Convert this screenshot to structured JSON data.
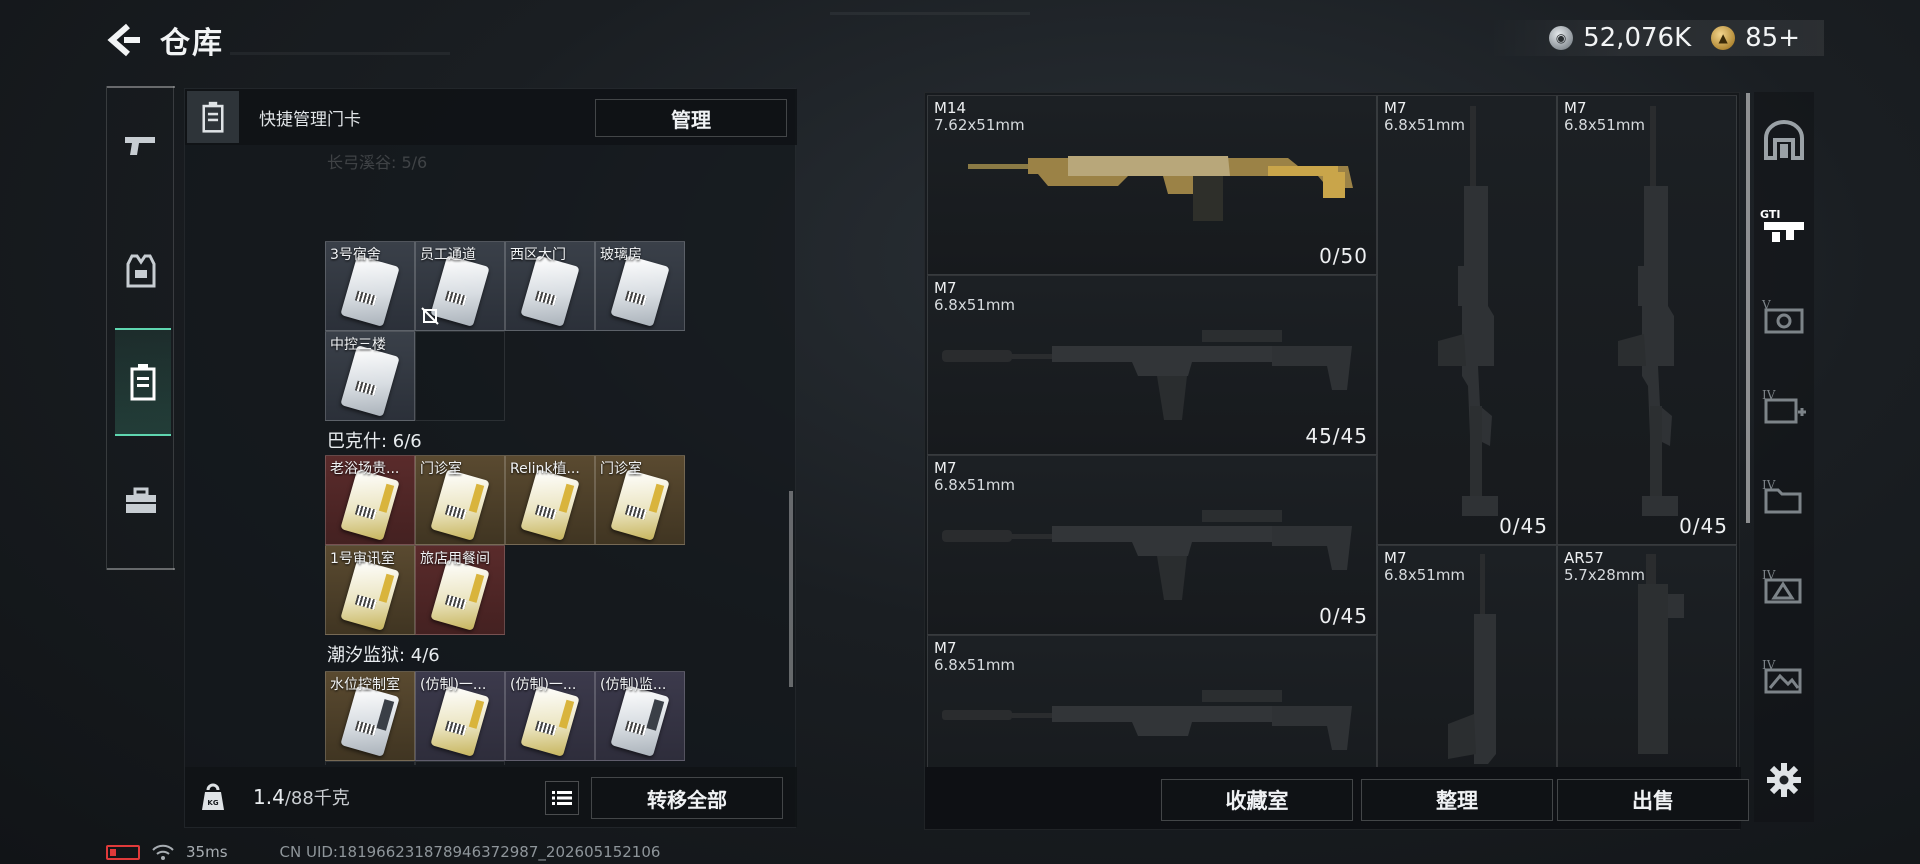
{
  "header": {
    "title": "仓库",
    "currency": [
      {
        "icon": "silver-coin-icon",
        "value": "52,076K"
      },
      {
        "icon": "gold-token-icon",
        "value": "85+"
      }
    ]
  },
  "left_nav": [
    {
      "icon": "pistol-icon",
      "active": false
    },
    {
      "icon": "vest-icon",
      "active": false
    },
    {
      "icon": "keycard-icon",
      "active": true
    },
    {
      "icon": "toolbox-icon",
      "active": false
    }
  ],
  "left_panel": {
    "title": "快捷管理门卡",
    "manage_label": "管理",
    "ghost_heading": "长弓溪谷: 5/6",
    "section_1": {
      "cards": [
        {
          "label": "3号宿舍",
          "color": "blue",
          "card": "white"
        },
        {
          "label": "员工通道",
          "color": "blue",
          "card": "white",
          "no_entry": true
        },
        {
          "label": "西区大门",
          "color": "blue",
          "card": "white"
        },
        {
          "label": "玻璃房",
          "color": "blue",
          "card": "white"
        },
        {
          "label": "中控三楼",
          "color": "blue",
          "card": "white"
        }
      ]
    },
    "section_2": {
      "title": "巴克什: 6/6",
      "cards": [
        {
          "label": "老浴场贵...",
          "color": "red",
          "card": "yellow"
        },
        {
          "label": "门诊室",
          "color": "gold",
          "card": "yellow"
        },
        {
          "label": "Relink植...",
          "color": "gold",
          "card": "yellow"
        },
        {
          "label": "门诊室",
          "color": "gold",
          "card": "yellow"
        },
        {
          "label": "1号审讯室",
          "color": "gold",
          "card": "yellow"
        },
        {
          "label": "旅店用餐间",
          "color": "red",
          "card": "yellow"
        }
      ]
    },
    "section_3": {
      "title": "潮汐监狱: 4/6",
      "cards": [
        {
          "label": "水位控制室",
          "color": "gold",
          "card": "dark"
        },
        {
          "label": "(仿制)一...",
          "color": "purple",
          "card": "yellow"
        },
        {
          "label": "(仿制)一...",
          "color": "purple",
          "card": "yellow"
        },
        {
          "label": "(仿制)监...",
          "color": "purple",
          "card": "dark"
        }
      ]
    },
    "weight_value": "1.4",
    "weight_max": "/88千克",
    "transfer_label": "转移全部"
  },
  "weapons": [
    {
      "name": "M14",
      "caliber": "7.62x51mm",
      "ammo": "0/50",
      "style": "gold"
    },
    {
      "name": "M7",
      "caliber": "6.8x51mm",
      "ammo": "0/45",
      "style": "vertical"
    },
    {
      "name": "M7",
      "caliber": "6.8x51mm",
      "ammo": "0/45",
      "style": "vertical"
    },
    {
      "name": "M7",
      "caliber": "6.8x51mm",
      "ammo": "45/45",
      "style": "black"
    },
    {
      "name": "M7",
      "caliber": "6.8x51mm",
      "ammo": "0/45",
      "style": "black"
    },
    {
      "name": "M7",
      "caliber": "6.8x51mm",
      "ammo": "",
      "style": "vertical"
    },
    {
      "name": "AR57",
      "caliber": "5.7x28mm",
      "ammo": "",
      "style": "vertical"
    },
    {
      "name": "M7",
      "caliber": "6.8x51mm",
      "ammo": "",
      "style": "black"
    }
  ],
  "right_footer": {
    "collection_label": "收藏室",
    "sort_label": "整理",
    "sell_label": "出售"
  },
  "right_strip": [
    {
      "icon": "bunker-icon",
      "label": ""
    },
    {
      "icon": "gti-rifle-icon",
      "label": "GTI"
    },
    {
      "icon": "tier-v-safe-icon",
      "label": "V"
    },
    {
      "icon": "tier-iv-medkit-icon",
      "label": "IV"
    },
    {
      "icon": "tier-iv-folder-icon",
      "label": "IV"
    },
    {
      "icon": "tier-iv-triangle-icon",
      "label": "IV"
    },
    {
      "icon": "tier-iv-mountain-icon",
      "label": "IV"
    },
    {
      "icon": "settings-gear-icon",
      "label": ""
    }
  ],
  "status_bar": {
    "ping": "35ms",
    "uid": "CN UID:1819662318789463729​87_202605152106"
  }
}
